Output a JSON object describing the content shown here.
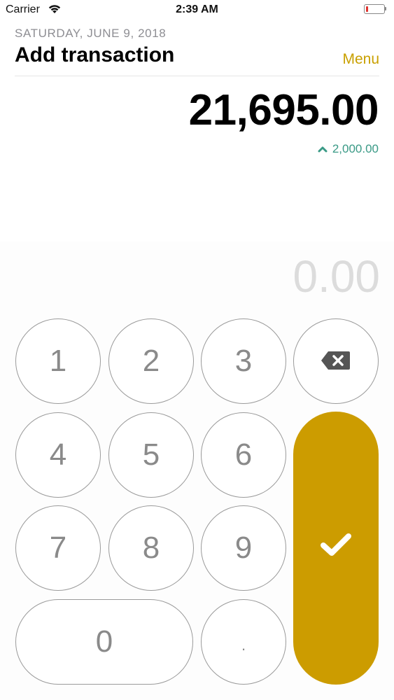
{
  "status_bar": {
    "carrier": "Carrier",
    "time": "2:39 AM",
    "icons": [
      "wifi-icon",
      "battery-icon"
    ]
  },
  "header": {
    "date": "SATURDAY, JUNE 9, 2018",
    "title": "Add transaction",
    "menu_label": "Menu"
  },
  "balance": {
    "amount": "21,695.00",
    "change": "2,000.00",
    "change_icon": "caret-up-icon",
    "change_color": "#3a9a86"
  },
  "entry": {
    "value": "0.00"
  },
  "keypad": {
    "keys": [
      "1",
      "2",
      "3",
      "4",
      "5",
      "6",
      "7",
      "8",
      "9",
      "0",
      "."
    ],
    "backspace_icon": "backspace-icon",
    "confirm_icon": "checkmark-icon"
  },
  "colors": {
    "accent": "#cc9c00",
    "menu_text": "#c9a000",
    "positive": "#3a9a86"
  }
}
